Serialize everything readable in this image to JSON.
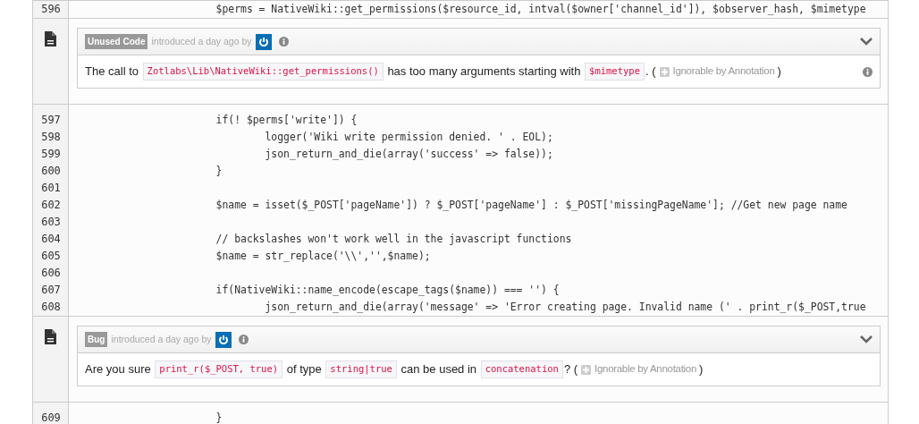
{
  "rows": [
    {
      "kind": "code",
      "number": "596",
      "code": "\t\t\t$perms = NativeWiki::get_permissions($resource_id, intval($owner['channel_id']), $observer_hash, $mimetype"
    },
    {
      "kind": "issue",
      "category": "Unused Code",
      "meta": "introduced a day ago by",
      "expanded": false,
      "info_button": true,
      "message": [
        {
          "kind": "text",
          "text": "The call to "
        },
        {
          "kind": "code",
          "text": "Zotlabs\\Lib\\NativeWiki::get_permissions()"
        },
        {
          "kind": "text",
          "text": " has too many arguments starting with "
        },
        {
          "kind": "code",
          "text": "$mimetype"
        },
        {
          "kind": "text",
          "text": ". ("
        },
        {
          "kind": "annotation",
          "text": "Ignorable by Annotation"
        },
        {
          "kind": "text",
          "text": ")"
        }
      ]
    },
    {
      "kind": "code",
      "number": "597",
      "code": "\t\t\tif(! $perms['write']) {"
    },
    {
      "kind": "code",
      "number": "598",
      "code": "\t\t\t\tlogger('Wiki write permission denied. ' . EOL);"
    },
    {
      "kind": "code",
      "number": "599",
      "code": "\t\t\t\tjson_return_and_die(array('success' => false));"
    },
    {
      "kind": "code",
      "number": "600",
      "code": "\t\t\t}"
    },
    {
      "kind": "code",
      "number": "601"
    },
    {
      "kind": "code",
      "number": "602",
      "code": "\t\t\t$name = isset($_POST['pageName']) ? $_POST['pageName'] : $_POST['missingPageName']; //Get new page name"
    },
    {
      "kind": "code",
      "number": "603"
    },
    {
      "kind": "code",
      "number": "604",
      "code": "\t\t\t// backslashes won't work well in the javascript functions"
    },
    {
      "kind": "code",
      "number": "605",
      "code": "\t\t\t$name = str_replace('\\\\','',$name);"
    },
    {
      "kind": "code",
      "number": "606"
    },
    {
      "kind": "code",
      "number": "607",
      "code": "\t\t\tif(NativeWiki::name_encode(escape_tags($name)) === '') {"
    },
    {
      "kind": "code",
      "number": "608",
      "code": "\t\t\t\tjson_return_and_die(array('message' => 'Error creating page. Invalid name (' . print_r($_POST,true"
    },
    {
      "kind": "issue",
      "category": "Bug",
      "meta": "introduced a day ago by",
      "expanded": false,
      "info_button": false,
      "message": [
        {
          "kind": "text",
          "text": "Are you sure "
        },
        {
          "kind": "code",
          "text": "print_r($_POST, true)"
        },
        {
          "kind": "text",
          "text": " of type "
        },
        {
          "kind": "code",
          "text": "string|true"
        },
        {
          "kind": "text",
          "text": " can be used in "
        },
        {
          "kind": "code",
          "text": "concatenation"
        },
        {
          "kind": "text",
          "text": "? ("
        },
        {
          "kind": "annotation",
          "text": "Ignorable by Annotation"
        },
        {
          "kind": "text",
          "text": ")"
        }
      ]
    },
    {
      "kind": "code",
      "number": "609",
      "code": "\t\t\t}"
    }
  ]
}
